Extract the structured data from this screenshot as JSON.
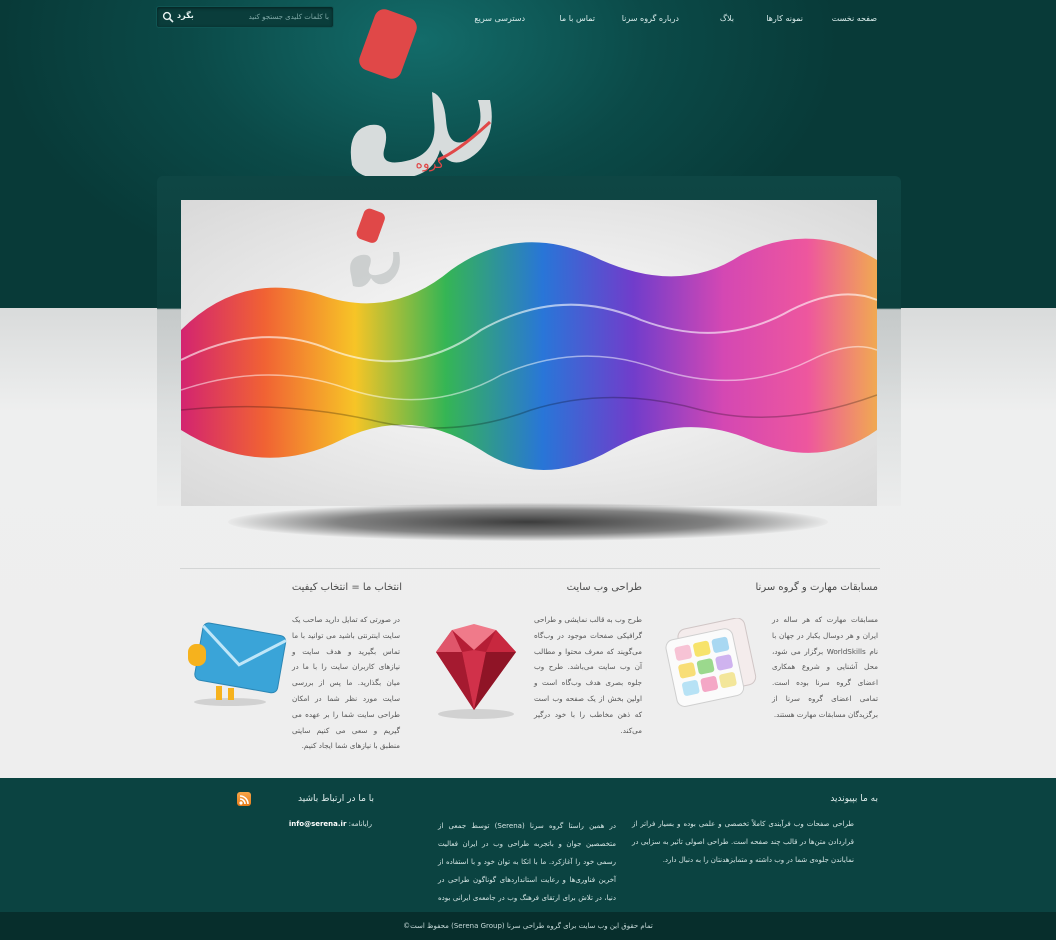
{
  "nav": {
    "items": [
      "صفحه نخست",
      "نمونه کارها",
      "بلاگ",
      "درباره گروه سرنا",
      "تماس با ما",
      "دسترسی سریع"
    ]
  },
  "search": {
    "placeholder": "با کلمات کلیدی جستجو کنید",
    "button_label": "بگرد"
  },
  "logo": {
    "text": "سرنا",
    "subtext": "گروه"
  },
  "features": [
    {
      "title": "مسابقات مهارت و گروه سرنا",
      "text": "مسابقات مهارت که هر ساله در ایران و هر دوسال یکبار در جهان با نام WorldSkills برگزار می شود، محل آشنایی و شروع همکاری اعضای گروه سرنا بوده است. تمامی اعضای گروه سرنا از برگزیدگان مسابقات مهارت هستند."
    },
    {
      "title": "طراحی وب سایت",
      "text": "طرح وب به قالب نمایشی و طراحی گرافیکی صفحات موجود در وب‌گاه می‌گویند که معرف محتوا و مطالب آن وب سایت می‌باشد. طرح وب جلوه بصری هدف وب‌گاه است و اولین بخش از یک صفحه وب است که ذهن مخاطب را با خود درگیر می‌کند."
    },
    {
      "title": "انتخاب ما = انتخاب کیفیت",
      "text": "در صورتی که تمایل دارید صاحب یک سایت اینترنتی باشید می توانید با ما تماس بگیرید و هدف سایت و نیازهای کاربران سایت را با ما در میان بگذارید. ما پس از بررسی سایت مورد نظر شما در امکان طراحی سایت شما را بر عهده می گیریم و سعی می کنیم سایتی منطبق با نیازهای شما ایجاد کنیم."
    }
  ],
  "footer": {
    "about_title": "به ما بپیوندید",
    "about_text": "طراحی صفحات وب فرآیندی کاملاً تخصصی و علمی بوده و بسیار فراتر از قراردادن متن‌ها در قالب چند صفحه است. طراحی اصولی تاثیر به سزایی در نمایاندن جلوه‌ی شما در وب داشته و متمایزهدنتان را به دنبال دارد.",
    "contact_title": "با ما در ارتباط باشید",
    "contact_text": "در همین راستا گروه سرنا (Serena) توسط جمعی از متخصصین جوان و باتجربه طراحی وب در ایران فعالیت رسمی خود را آغازکرد. ما با اتکا به توان خود و با استفاده از آخرین فناوری‌ها و رعایت استانداردهای گوناگون طراحی در دنیا، در تلاش برای ارتقای فرهنگ وب در جامعه‌ی ایرانی بوده و هستیم.",
    "email_label": "رایانامه:",
    "email_value": "info@serena.ir",
    "copyright": "تمام حقوق این وب سایت برای گروه طراحی سرنا (Serena Group) محفوظ است©"
  },
  "colors": {
    "header_teal": "#0b4a48",
    "logo_red": "#e04848",
    "footer_teal": "#0b4341"
  }
}
